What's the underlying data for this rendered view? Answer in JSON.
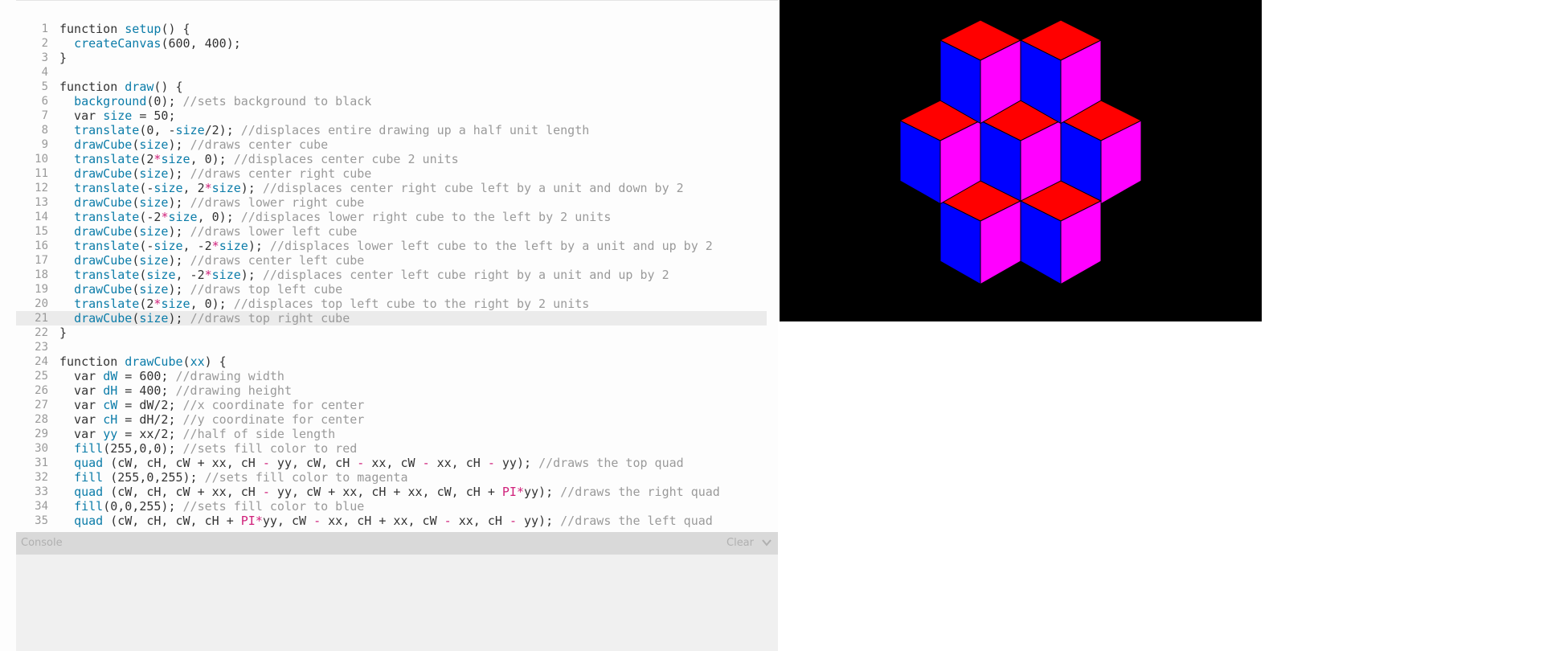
{
  "editor": {
    "active_line": 21,
    "lines": [
      [
        [
          "k",
          "function "
        ],
        [
          "f",
          "setup"
        ],
        [
          "p",
          "() {"
        ]
      ],
      [
        [
          "p",
          "  "
        ],
        [
          "f",
          "createCanvas"
        ],
        [
          "p",
          "(600, 400);"
        ]
      ],
      [
        [
          "p",
          "}"
        ]
      ],
      [],
      [
        [
          "k",
          "function "
        ],
        [
          "f",
          "draw"
        ],
        [
          "p",
          "() {"
        ]
      ],
      [
        [
          "p",
          "  "
        ],
        [
          "f",
          "background"
        ],
        [
          "p",
          "(0); "
        ],
        [
          "c",
          "//sets background to black"
        ]
      ],
      [
        [
          "p",
          "  var "
        ],
        [
          "v",
          "size"
        ],
        [
          "p",
          " = 50;"
        ]
      ],
      [
        [
          "p",
          "  "
        ],
        [
          "f",
          "translate"
        ],
        [
          "p",
          "(0, -"
        ],
        [
          "v",
          "size"
        ],
        [
          "p",
          "/2); "
        ],
        [
          "c",
          "//displaces entire drawing up a half unit length"
        ]
      ],
      [
        [
          "p",
          "  "
        ],
        [
          "f",
          "drawCube"
        ],
        [
          "p",
          "("
        ],
        [
          "v",
          "size"
        ],
        [
          "p",
          "); "
        ],
        [
          "c",
          "//draws center cube"
        ]
      ],
      [
        [
          "p",
          "  "
        ],
        [
          "f",
          "translate"
        ],
        [
          "p",
          "(2"
        ],
        [
          "o",
          "*"
        ],
        [
          "v",
          "size"
        ],
        [
          "p",
          ", 0); "
        ],
        [
          "c",
          "//displaces center cube 2 units"
        ]
      ],
      [
        [
          "p",
          "  "
        ],
        [
          "f",
          "drawCube"
        ],
        [
          "p",
          "("
        ],
        [
          "v",
          "size"
        ],
        [
          "p",
          "); "
        ],
        [
          "c",
          "//draws center right cube"
        ]
      ],
      [
        [
          "p",
          "  "
        ],
        [
          "f",
          "translate"
        ],
        [
          "p",
          "(-"
        ],
        [
          "v",
          "size"
        ],
        [
          "p",
          ", 2"
        ],
        [
          "o",
          "*"
        ],
        [
          "v",
          "size"
        ],
        [
          "p",
          "); "
        ],
        [
          "c",
          "//displaces center right cube left by a unit and down by 2"
        ]
      ],
      [
        [
          "p",
          "  "
        ],
        [
          "f",
          "drawCube"
        ],
        [
          "p",
          "("
        ],
        [
          "v",
          "size"
        ],
        [
          "p",
          "); "
        ],
        [
          "c",
          "//draws lower right cube"
        ]
      ],
      [
        [
          "p",
          "  "
        ],
        [
          "f",
          "translate"
        ],
        [
          "p",
          "(-2"
        ],
        [
          "o",
          "*"
        ],
        [
          "v",
          "size"
        ],
        [
          "p",
          ", 0); "
        ],
        [
          "c",
          "//displaces lower right cube to the left by 2 units"
        ]
      ],
      [
        [
          "p",
          "  "
        ],
        [
          "f",
          "drawCube"
        ],
        [
          "p",
          "("
        ],
        [
          "v",
          "size"
        ],
        [
          "p",
          "); "
        ],
        [
          "c",
          "//draws lower left cube"
        ]
      ],
      [
        [
          "p",
          "  "
        ],
        [
          "f",
          "translate"
        ],
        [
          "p",
          "(-"
        ],
        [
          "v",
          "size"
        ],
        [
          "p",
          ", -2"
        ],
        [
          "o",
          "*"
        ],
        [
          "v",
          "size"
        ],
        [
          "p",
          "); "
        ],
        [
          "c",
          "//displaces lower left cube to the left by a unit and up by 2"
        ]
      ],
      [
        [
          "p",
          "  "
        ],
        [
          "f",
          "drawCube"
        ],
        [
          "p",
          "("
        ],
        [
          "v",
          "size"
        ],
        [
          "p",
          "); "
        ],
        [
          "c",
          "//draws center left cube"
        ]
      ],
      [
        [
          "p",
          "  "
        ],
        [
          "f",
          "translate"
        ],
        [
          "p",
          "("
        ],
        [
          "v",
          "size"
        ],
        [
          "p",
          ", -2"
        ],
        [
          "o",
          "*"
        ],
        [
          "v",
          "size"
        ],
        [
          "p",
          "); "
        ],
        [
          "c",
          "//displaces center left cube right by a unit and up by 2"
        ]
      ],
      [
        [
          "p",
          "  "
        ],
        [
          "f",
          "drawCube"
        ],
        [
          "p",
          "("
        ],
        [
          "v",
          "size"
        ],
        [
          "p",
          "); "
        ],
        [
          "c",
          "//draws top left cube"
        ]
      ],
      [
        [
          "p",
          "  "
        ],
        [
          "f",
          "translate"
        ],
        [
          "p",
          "(2"
        ],
        [
          "o",
          "*"
        ],
        [
          "v",
          "size"
        ],
        [
          "p",
          ", 0); "
        ],
        [
          "c",
          "//displaces top left cube to the right by 2 units"
        ]
      ],
      [
        [
          "p",
          "  "
        ],
        [
          "f",
          "drawCube"
        ],
        [
          "p",
          "("
        ],
        [
          "v",
          "size"
        ],
        [
          "p",
          "); "
        ],
        [
          "c",
          "//draws top right cube"
        ]
      ],
      [
        [
          "p",
          "}"
        ]
      ],
      [],
      [
        [
          "k",
          "function "
        ],
        [
          "f",
          "drawCube"
        ],
        [
          "p",
          "("
        ],
        [
          "v",
          "xx"
        ],
        [
          "p",
          ") {"
        ]
      ],
      [
        [
          "p",
          "  var "
        ],
        [
          "v",
          "dW"
        ],
        [
          "p",
          " = 600; "
        ],
        [
          "c",
          "//drawing width"
        ]
      ],
      [
        [
          "p",
          "  var "
        ],
        [
          "v",
          "dH"
        ],
        [
          "p",
          " = 400; "
        ],
        [
          "c",
          "//drawing height"
        ]
      ],
      [
        [
          "p",
          "  var "
        ],
        [
          "v",
          "cW"
        ],
        [
          "p",
          " = dW/2; "
        ],
        [
          "c",
          "//x coordinate for center"
        ]
      ],
      [
        [
          "p",
          "  var "
        ],
        [
          "v",
          "cH"
        ],
        [
          "p",
          " = dH/2; "
        ],
        [
          "c",
          "//y coordinate for center"
        ]
      ],
      [
        [
          "p",
          "  var "
        ],
        [
          "v",
          "yy"
        ],
        [
          "p",
          " = xx/2; "
        ],
        [
          "c",
          "//half of side length"
        ]
      ],
      [
        [
          "p",
          "  "
        ],
        [
          "f",
          "fill"
        ],
        [
          "p",
          "(255,0,0); "
        ],
        [
          "c",
          "//sets fill color to red"
        ]
      ],
      [
        [
          "p",
          "  "
        ],
        [
          "f",
          "quad"
        ],
        [
          "p",
          " (cW, cH, cW + xx, cH "
        ],
        [
          "o",
          "-"
        ],
        [
          "p",
          " yy, cW, cH "
        ],
        [
          "o",
          "-"
        ],
        [
          "p",
          " xx, cW "
        ],
        [
          "o",
          "-"
        ],
        [
          "p",
          " xx, cH "
        ],
        [
          "o",
          "-"
        ],
        [
          "p",
          " yy); "
        ],
        [
          "c",
          "//draws the top quad"
        ]
      ],
      [
        [
          "p",
          "  "
        ],
        [
          "f",
          "fill"
        ],
        [
          "p",
          " (255,0,255); "
        ],
        [
          "c",
          "//sets fill color to magenta"
        ]
      ],
      [
        [
          "p",
          "  "
        ],
        [
          "f",
          "quad"
        ],
        [
          "p",
          " (cW, cH, cW + xx, cH "
        ],
        [
          "o",
          "-"
        ],
        [
          "p",
          " yy, cW + xx, cH + xx, cW, cH + "
        ],
        [
          "x",
          "PI"
        ],
        [
          "o",
          "*"
        ],
        [
          "p",
          "yy); "
        ],
        [
          "c",
          "//draws the right quad"
        ]
      ],
      [
        [
          "p",
          "  "
        ],
        [
          "f",
          "fill"
        ],
        [
          "p",
          "(0,0,255); "
        ],
        [
          "c",
          "//sets fill color to blue"
        ]
      ],
      [
        [
          "p",
          "  "
        ],
        [
          "f",
          "quad"
        ],
        [
          "p",
          " (cW, cH, cW, cH + "
        ],
        [
          "x",
          "PI"
        ],
        [
          "o",
          "*"
        ],
        [
          "p",
          "yy, cW "
        ],
        [
          "o",
          "-"
        ],
        [
          "p",
          " xx, cH + xx, cW "
        ],
        [
          "o",
          "-"
        ],
        [
          "p",
          " xx, cH "
        ],
        [
          "o",
          "-"
        ],
        [
          "p",
          " yy); "
        ],
        [
          "c",
          "//draws the left quad"
        ]
      ]
    ]
  },
  "console": {
    "title": "Console",
    "clear_label": "Clear"
  },
  "canvas": {
    "background": "#000000",
    "face_colors": {
      "top": "#ff0000",
      "right": "#ff00ff",
      "left": "#0000ff"
    },
    "cube_size": 50,
    "cube_offsets": [
      [
        0,
        0
      ],
      [
        2,
        0
      ],
      [
        1,
        2
      ],
      [
        -1,
        2
      ],
      [
        -2,
        0
      ],
      [
        -1,
        -2
      ],
      [
        1,
        -2
      ]
    ]
  }
}
